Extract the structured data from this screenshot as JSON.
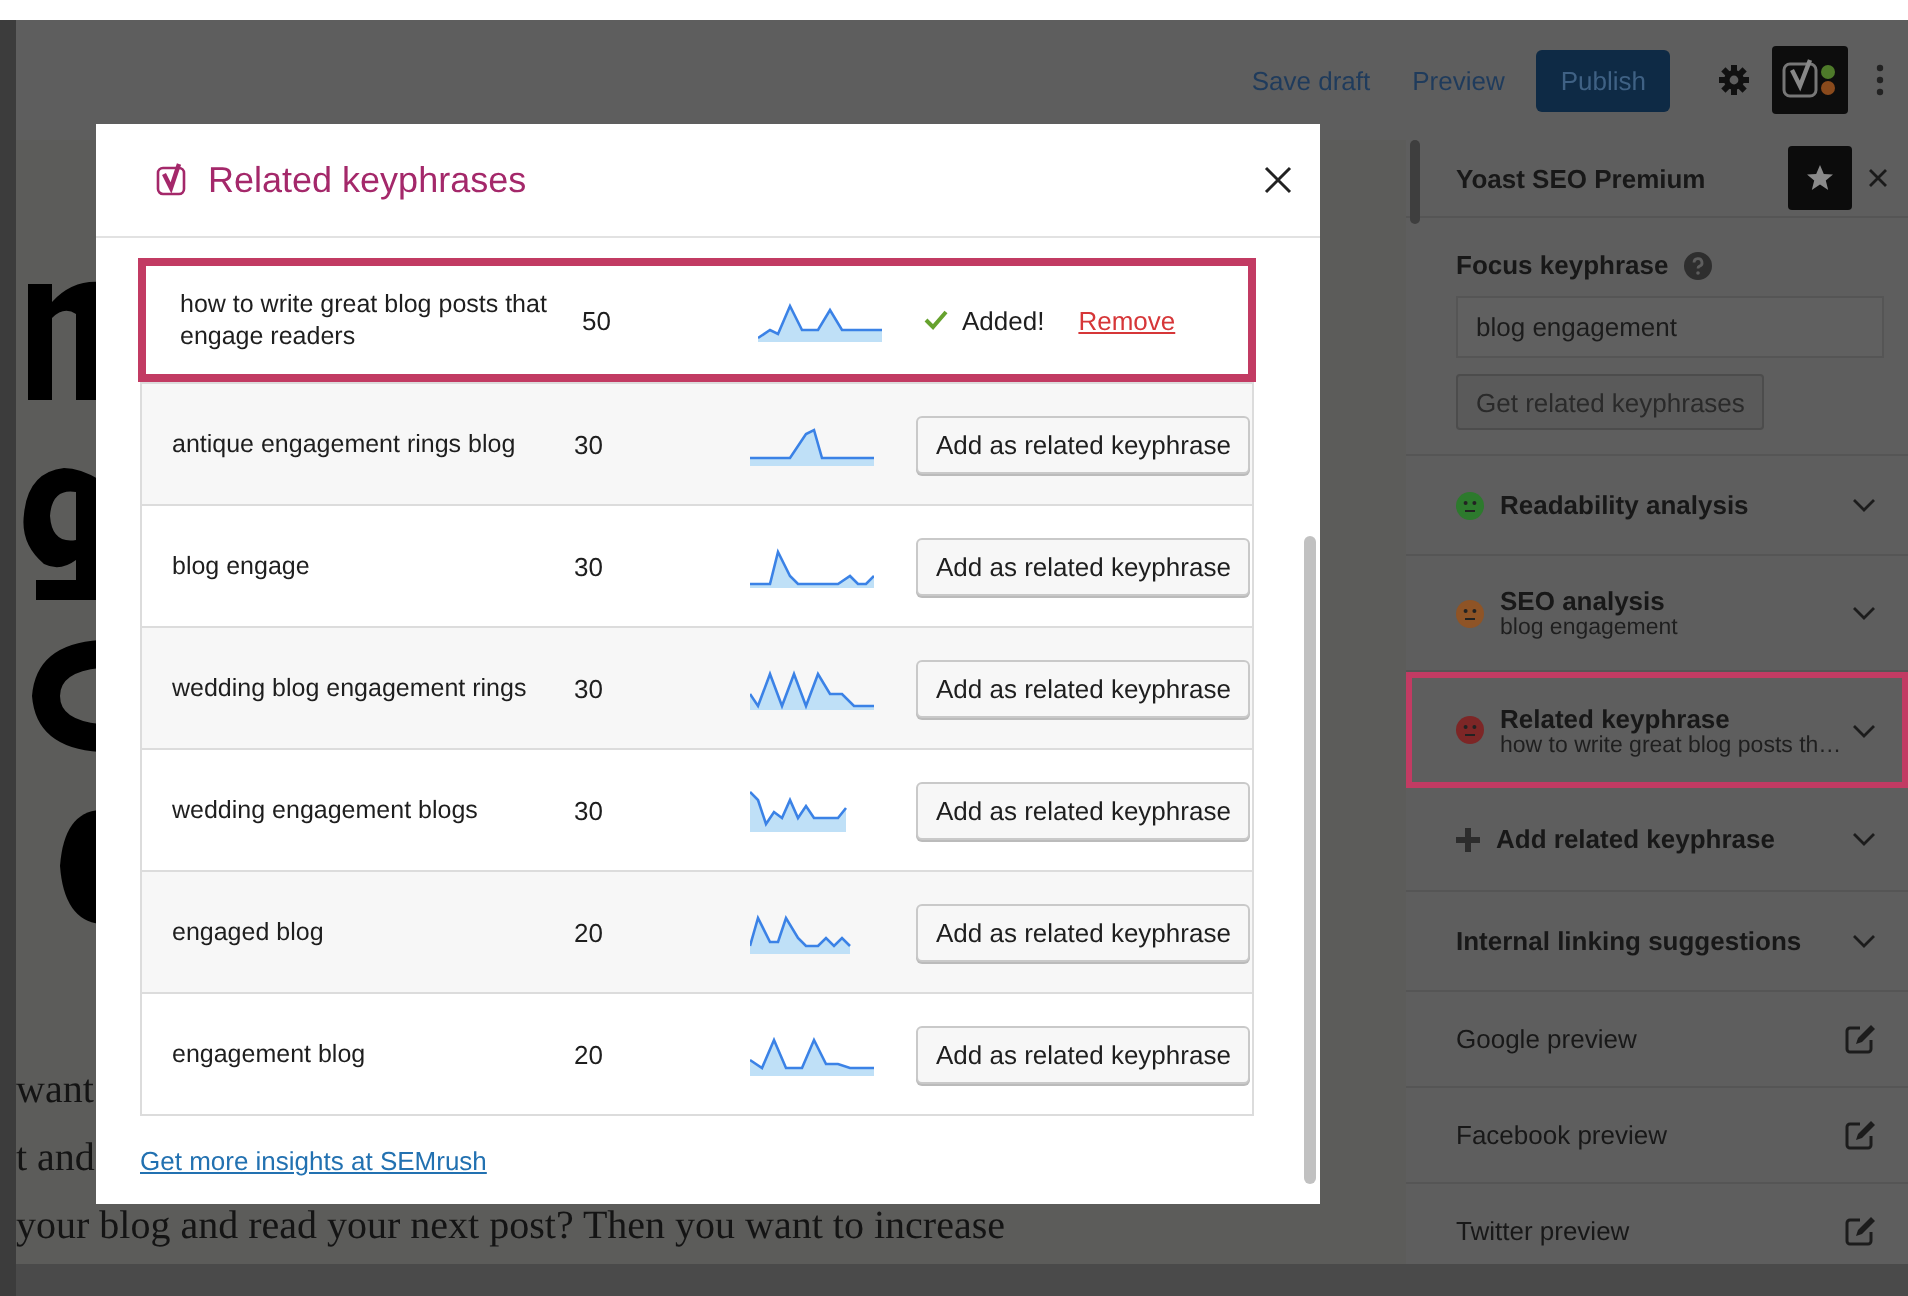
{
  "toolbar": {
    "save_draft": "Save draft",
    "preview": "Preview",
    "publish": "Publish"
  },
  "editor": {
    "paragraph_fragments": [
      "want",
      "t and",
      "your blog and read your next post? Then you want to increase"
    ]
  },
  "modal": {
    "title": "Related keyphrases",
    "footer_link": "Get more insights at SEMrush",
    "rows": [
      {
        "keyphrase": "how to write great blog posts that engage readers",
        "volume": "50",
        "added": true,
        "highlighted": true,
        "status": "Added!",
        "link": "Remove"
      },
      {
        "keyphrase": "antique engagement rings blog",
        "volume": "30",
        "added": false,
        "highlighted": false,
        "button": "Add as related keyphrase"
      },
      {
        "keyphrase": "blog engage",
        "volume": "30",
        "added": false,
        "highlighted": false,
        "button": "Add as related keyphrase"
      },
      {
        "keyphrase": "wedding blog engagement rings",
        "volume": "30",
        "added": false,
        "highlighted": false,
        "button": "Add as related keyphrase"
      },
      {
        "keyphrase": "wedding engagement blogs",
        "volume": "30",
        "added": false,
        "highlighted": false,
        "button": "Add as related keyphrase"
      },
      {
        "keyphrase": "engaged blog",
        "volume": "20",
        "added": false,
        "highlighted": false,
        "button": "Add as related keyphrase"
      },
      {
        "keyphrase": "engagement blog",
        "volume": "20",
        "added": false,
        "highlighted": false,
        "button": "Add as related keyphrase"
      }
    ]
  },
  "sidebar": {
    "title": "Yoast SEO Premium",
    "focus_label": "Focus keyphrase",
    "focus_value": "blog engagement",
    "get_button": "Get related keyphrases",
    "sections": [
      {
        "kind": "score",
        "title": "Readability analysis",
        "color": "#2d7a2d",
        "highlighted": false
      },
      {
        "kind": "score",
        "title": "SEO analysis",
        "subtitle": "blog engagement",
        "color": "#8f5426",
        "highlighted": false
      },
      {
        "kind": "score",
        "title": "Related keyphrase",
        "subtitle": "how to write great blog posts th…",
        "color": "#7d2626",
        "highlighted": true
      },
      {
        "kind": "add",
        "title": "Add related keyphrase",
        "highlighted": false
      },
      {
        "kind": "collapsible",
        "title": "Internal linking suggestions",
        "highlighted": false
      },
      {
        "kind": "preview",
        "title": "Google preview",
        "highlighted": false
      },
      {
        "kind": "preview",
        "title": "Facebook preview",
        "highlighted": false
      },
      {
        "kind": "preview",
        "title": "Twitter preview",
        "highlighted": false
      }
    ]
  }
}
